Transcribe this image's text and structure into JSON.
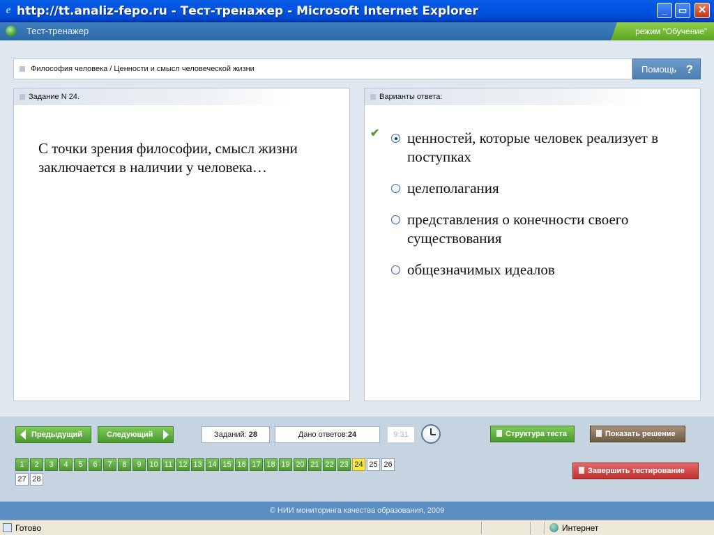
{
  "window": {
    "title": "http://tt.analiz-fepo.ru - Тест-тренажер - Microsoft Internet Explorer",
    "minimize": "_",
    "maximize": "▭",
    "close": "✕"
  },
  "app": {
    "title": "Тест-тренажер",
    "mode": "режим \"Обучение\""
  },
  "breadcrumb": {
    "text": "Философия человека / Ценности и смысл человеческой жизни"
  },
  "help": {
    "label": "Помощь",
    "icon_glyph": "?"
  },
  "task": {
    "header": "Задание N 24.",
    "question": "С точки зрения философии, смысл жизни  заключается в наличии у человека…"
  },
  "answers": {
    "header": "Варианты ответа:",
    "options": [
      {
        "text": "ценностей, которые человек реализует в поступках",
        "selected": true,
        "correct_mark": "✔"
      },
      {
        "text": "целеполагания",
        "selected": false
      },
      {
        "text": "представления о конечности своего существования",
        "selected": false
      },
      {
        "text": "общезначимых идеалов",
        "selected": false
      }
    ]
  },
  "navigation": {
    "prev_label": "Предыдущий",
    "next_label": "Следующий",
    "tasks_label": "Заданий:",
    "tasks_count": "28",
    "answers_label": "Дано ответов:",
    "answers_count": "24",
    "timer": "9:31",
    "structure_label": "Структура теста",
    "solution_label": "Показать решение",
    "finish_label": "Завершить тестирование",
    "questions": [
      {
        "n": "1",
        "state": "answered"
      },
      {
        "n": "2",
        "state": "answered"
      },
      {
        "n": "3",
        "state": "answered"
      },
      {
        "n": "4",
        "state": "answered"
      },
      {
        "n": "5",
        "state": "answered"
      },
      {
        "n": "6",
        "state": "answered"
      },
      {
        "n": "7",
        "state": "answered"
      },
      {
        "n": "8",
        "state": "answered"
      },
      {
        "n": "9",
        "state": "answered"
      },
      {
        "n": "10",
        "state": "answered"
      },
      {
        "n": "11",
        "state": "answered"
      },
      {
        "n": "12",
        "state": "answered"
      },
      {
        "n": "13",
        "state": "answered"
      },
      {
        "n": "14",
        "state": "answered"
      },
      {
        "n": "15",
        "state": "answered"
      },
      {
        "n": "16",
        "state": "answered"
      },
      {
        "n": "17",
        "state": "answered"
      },
      {
        "n": "18",
        "state": "answered"
      },
      {
        "n": "19",
        "state": "answered"
      },
      {
        "n": "20",
        "state": "answered"
      },
      {
        "n": "21",
        "state": "answered"
      },
      {
        "n": "22",
        "state": "answered"
      },
      {
        "n": "23",
        "state": "answered"
      },
      {
        "n": "24",
        "state": "current"
      },
      {
        "n": "25",
        "state": "empty"
      },
      {
        "n": "26",
        "state": "empty"
      },
      {
        "n": "27",
        "state": "empty"
      },
      {
        "n": "28",
        "state": "empty"
      }
    ]
  },
  "footer": {
    "copyright": "© НИИ мониторинга качества образования, 2009"
  },
  "statusbar": {
    "status": "Готово",
    "zone": "Интернет"
  },
  "colors": {
    "answered": "#4f9a35",
    "current": "#f6e64a",
    "empty": "#ffffff",
    "titlebar": "#0054e3",
    "appbar": "#2c69a8",
    "mode_badge": "#5aa624"
  }
}
